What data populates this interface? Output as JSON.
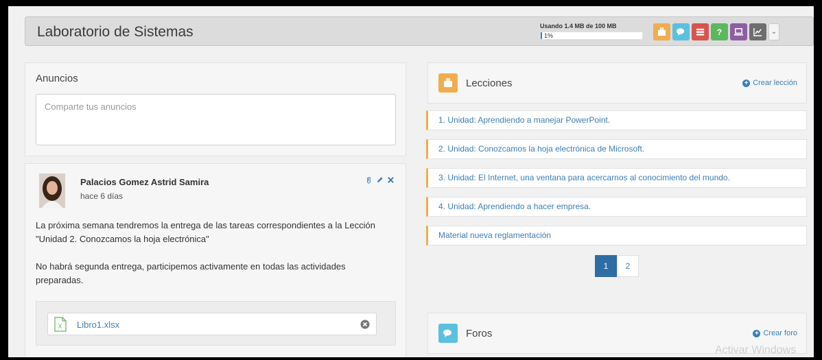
{
  "header": {
    "title": "Laboratorio de Sistemas",
    "storage_text": "Usando 1.4 MB de 100 MB",
    "storage_percent_label": "1%",
    "storage_fraction": 0.014,
    "tools": [
      {
        "name": "lessons-tool",
        "icon": "briefcase-icon",
        "color": "#f0ad4e"
      },
      {
        "name": "forums-tool",
        "icon": "chat-icon",
        "color": "#5bc0de"
      },
      {
        "name": "list-tool",
        "icon": "list-icon",
        "color": "#d9534f"
      },
      {
        "name": "help-tool",
        "icon": "question-icon",
        "color": "#5cb85c"
      },
      {
        "name": "laptop-tool",
        "icon": "laptop-icon",
        "color": "#8e5ea2"
      },
      {
        "name": "stats-tool",
        "icon": "chart-icon",
        "color": "#6e6e6e"
      }
    ]
  },
  "announcements": {
    "title": "Anuncios",
    "placeholder": "Comparte tus anuncios"
  },
  "post": {
    "author": "Palacios Gomez Astrid Samira",
    "time": "hace 6 días",
    "paragraph1": "La próxima semana tendremos la entrega de las tareas correspondientes a la Lección \"Unidad 2. Conozcamos la hoja electrónica\"",
    "paragraph2": "No habrá segunda entrega, participemos activamente en todas las actividades preparadas.",
    "attachment": "Libro1.xlsx"
  },
  "lessons": {
    "title": "Lecciones",
    "create_label": "Crear lección",
    "items": [
      "1. Unidad: Aprendiendo a manejar PowerPoint.",
      "2. Unidad: Conozcamos la hoja electrónica de Microsoft.",
      "3. Unidad: El Internet, una ventana para acercarnos al conocimiento del mundo.",
      "4. Unidad: Aprendiendo a hacer empresa.",
      "Material nueva reglamentación"
    ],
    "pages": [
      "1",
      "2"
    ],
    "active_page": "1"
  },
  "forums": {
    "title": "Foros",
    "create_label": "Crear foro"
  },
  "watermark": "Activar Windows",
  "colors": {
    "accent": "#3b7fb6",
    "lesson_bar": "#f0ad4e",
    "forum_icon": "#5bc0de"
  }
}
